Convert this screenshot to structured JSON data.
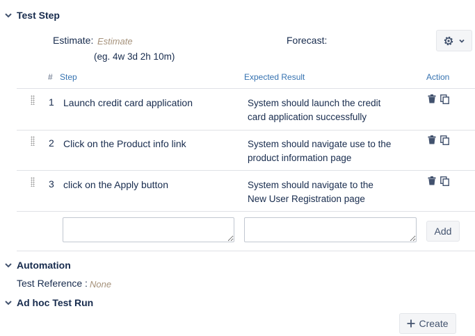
{
  "test_step": {
    "title": "Test Step",
    "estimate_label": "Estimate:",
    "estimate_placeholder": "Estimate",
    "estimate_hint": "(eg. 4w 3d 2h 10m)",
    "forecast_label": "Forecast:",
    "columns": {
      "num": "#",
      "step": "Step",
      "expected": "Expected Result",
      "action": "Action"
    },
    "rows": [
      {
        "num": "1",
        "step": "Launch credit card application",
        "expected": "System should launch the credit card application successfully"
      },
      {
        "num": "2",
        "step": "Click on the Product info link",
        "expected": "System should navigate use to the product information page"
      },
      {
        "num": "3",
        "step": "click on the Apply button",
        "expected": "System should navigate to the New User Registration page"
      }
    ],
    "new_step_value": "",
    "new_expected_value": "",
    "add_label": "Add"
  },
  "automation": {
    "title": "Automation",
    "test_reference_label": "Test Reference :",
    "test_reference_value": "None"
  },
  "adhoc": {
    "title": "Ad hoc Test Run",
    "create_label": "Create"
  },
  "icons": [
    "chevron-down-icon",
    "gear-icon",
    "drag-handle-icon",
    "trash-icon",
    "copy-icon",
    "plus-icon"
  ]
}
